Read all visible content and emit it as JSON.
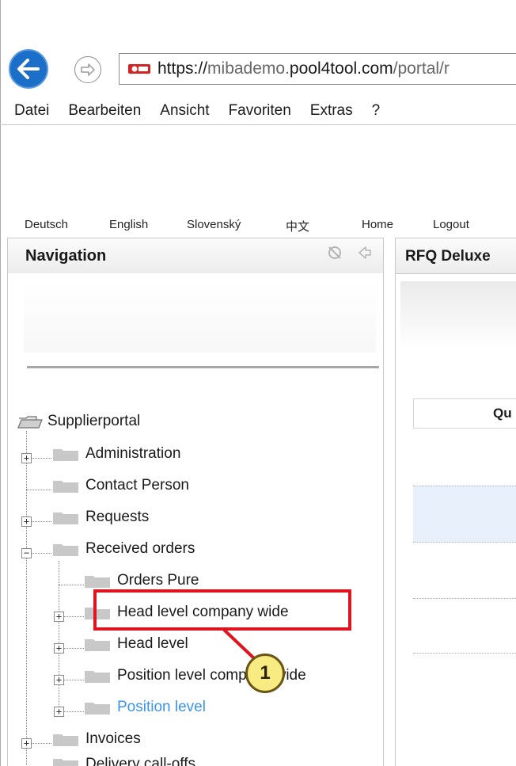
{
  "browser": {
    "url_scheme": "https://",
    "url_sub": "mibademo.",
    "url_host": "pool4tool.com",
    "url_path": "/portal/r"
  },
  "menu": [
    "Datei",
    "Bearbeiten",
    "Ansicht",
    "Favoriten",
    "Extras",
    "?"
  ],
  "top_links": {
    "deutsch": "Deutsch",
    "english": "English",
    "slovensky": "Slovenský",
    "chinese": "中文",
    "home": "Home",
    "logout": "Logout"
  },
  "navigation": {
    "title": "Navigation",
    "root": "Supplierportal",
    "items": [
      "Administration",
      "Contact Person",
      "Requests",
      "Received orders",
      "Orders Pure",
      "Head level company wide",
      "Head level",
      "Position level company wide",
      "Position level",
      "Invoices",
      "Delivery call-offs"
    ]
  },
  "main": {
    "title": "RFQ Deluxe",
    "column_header": "Qu"
  },
  "callout": {
    "number": "1"
  },
  "colors": {
    "accent_blue": "#1c6fc8",
    "active_link": "#3b95e8",
    "callout_red": "#e0141e",
    "badge_fill": "#f7eb82"
  }
}
